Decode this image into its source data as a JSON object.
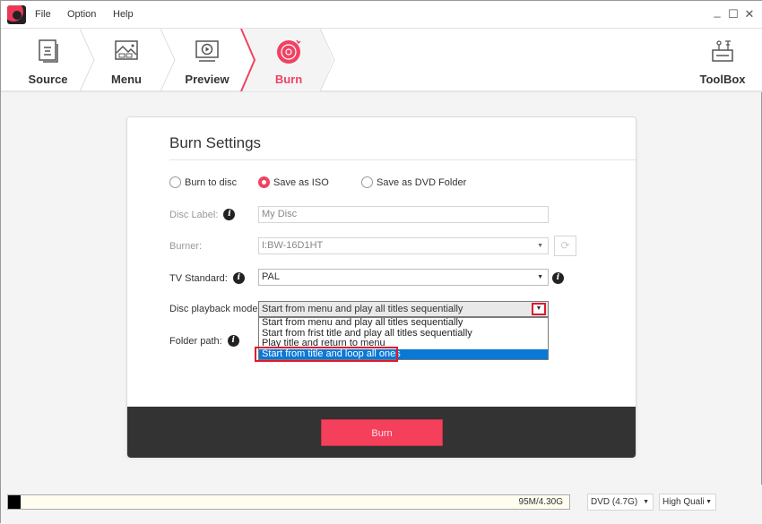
{
  "menubar": {
    "items": [
      "File",
      "Option",
      "Help"
    ]
  },
  "window_controls": {
    "minimize": "_",
    "maximize": "☐",
    "close": "✕"
  },
  "steps": [
    {
      "label": "Source",
      "icon": "document-icon",
      "active": false
    },
    {
      "label": "Menu",
      "icon": "image-menu-icon",
      "active": false
    },
    {
      "label": "Preview",
      "icon": "play-screen-icon",
      "active": false
    },
    {
      "label": "Burn",
      "icon": "disc-burn-icon",
      "active": true
    }
  ],
  "toolbox": {
    "label": "ToolBox",
    "icon": "toolbox-icon"
  },
  "accent_color": "#f04262",
  "burn_settings": {
    "title": "Burn Settings",
    "output_options": [
      {
        "label": "Burn to disc",
        "selected": false
      },
      {
        "label": "Save as ISO",
        "selected": true
      },
      {
        "label": "Save as DVD Folder",
        "selected": false
      }
    ],
    "disc_label": {
      "label": "Disc Label:",
      "value": "My Disc"
    },
    "burner": {
      "label": "Burner:",
      "value": "I:BW-16D1HT"
    },
    "tv_standard": {
      "label": "TV Standard:",
      "value": "PAL"
    },
    "playback_mode": {
      "label": "Disc playback mode:",
      "value": "Start from menu and play all titles sequentially",
      "options": [
        "Start from menu and play all titles sequentially",
        "Start from frist title and play all titles sequentially",
        "Play title and return to menu",
        "Start from title and loop all ones"
      ],
      "highlighted_index": 3
    },
    "folder_path": {
      "label": "Folder path:"
    },
    "burn_button": "Burn"
  },
  "statusbar": {
    "usage_text": "95M/4.30G",
    "usage_fraction": 0.022,
    "disc_type": "DVD (4.7G)",
    "quality": "High Quali"
  }
}
